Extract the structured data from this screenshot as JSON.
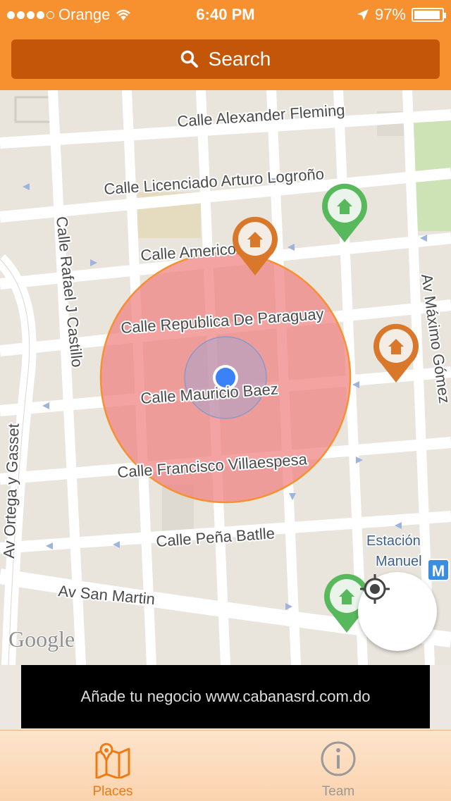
{
  "status_bar": {
    "carrier": "Orange",
    "time": "6:40 PM",
    "battery": "97%",
    "battery_level": 0.97
  },
  "search": {
    "label": "Search"
  },
  "map": {
    "streets": [
      "Calle Alexander Fleming",
      "Calle Licenciado Arturo Logroño",
      "Calle Americo Lugo",
      "Calle Republica De Paraguay",
      "Calle Mauricio Baez",
      "Calle Francisco Villaespesa",
      "Calle Peña Batlle",
      "Av San Martin",
      "Calle Rafael J Castillo",
      "Av Máximo Gómez",
      "Av Ortega y Gasset"
    ],
    "station": [
      "Estación",
      "Manuel"
    ],
    "metro_label": "M",
    "attribution": "Google",
    "colors": {
      "radius_fill": "#f08080",
      "radius_stroke": "#f7902f",
      "pin_orange": "#d9772b",
      "pin_green": "#58b85c",
      "user_dot": "#3b82f6"
    }
  },
  "banner": {
    "text": "Añade tu negocio www.cabanasrd.com.do"
  },
  "tabs": [
    {
      "label": "Places",
      "icon": "map-pin-icon",
      "active": true
    },
    {
      "label": "Team",
      "icon": "info-icon",
      "active": false
    }
  ]
}
